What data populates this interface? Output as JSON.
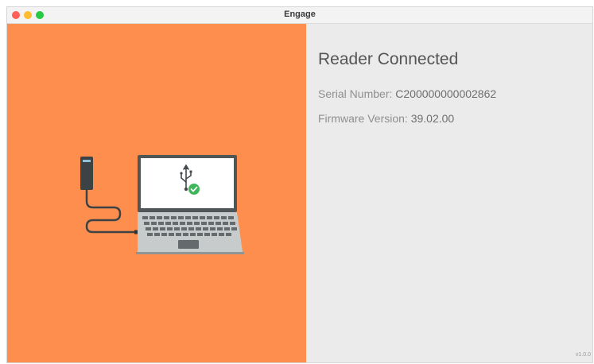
{
  "window": {
    "title": "Engage"
  },
  "status": {
    "title": "Reader Connected",
    "serial_label": "Serial Number:",
    "serial_value": "C200000000002862",
    "firmware_label": "Firmware Version:",
    "firmware_value": "39.02.00"
  },
  "footer": {
    "version": "v1.0.0"
  },
  "icons": {
    "illustration": "reader-connected-laptop-illustration",
    "usb": "usb-icon",
    "check": "check-badge-icon"
  },
  "colors": {
    "accent_panel": "#fe8e4e",
    "success": "#3fb65a",
    "close": "#fe5f57",
    "minimize": "#febc2e",
    "maximize": "#28c840"
  }
}
